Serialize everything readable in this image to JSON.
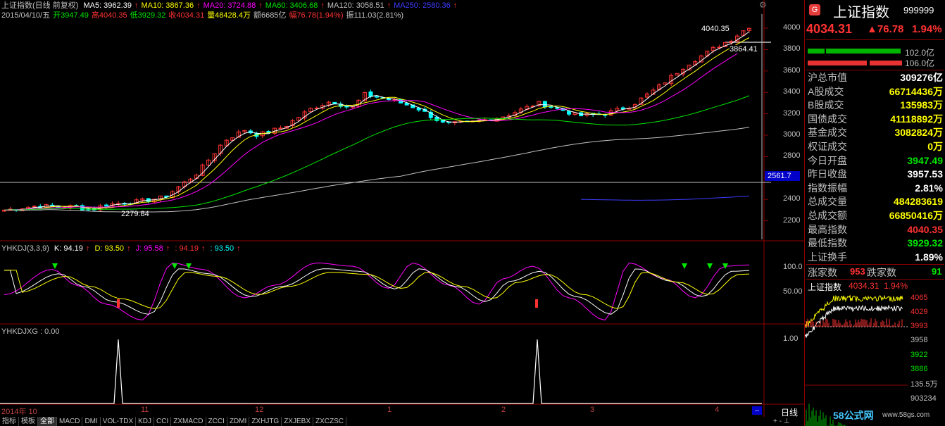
{
  "header": {
    "index_name": "上证指数(日线 前复权)",
    "ma": [
      {
        "label": "MA5: 3962.39",
        "color": "#ffffff"
      },
      {
        "label": "MA10: 3867.36",
        "color": "#ffff00"
      },
      {
        "label": "MA20: 3724.88",
        "color": "#ff00ff"
      },
      {
        "label": "MA60: 3406.68",
        "color": "#00e600"
      },
      {
        "label": "MA120: 3058.51",
        "color": "#c0c0c0"
      },
      {
        "label": "MA250: 2580.36",
        "color": "#3c3cff"
      }
    ],
    "date": "2015/04/10/五",
    "open": "开3947.49",
    "high": "高4040.35",
    "low": "低3929.32",
    "close": "收4034.31",
    "volume": "量48428.4万",
    "amount": "额6685亿",
    "change": "幅76.78(1.94%)",
    "amplitude": "振111.03(2.81%)"
  },
  "price_axis": [
    "4000",
    "3800",
    "3600",
    "3400",
    "3200",
    "3000",
    "2800",
    "2600",
    "2400",
    "2200"
  ],
  "price_marker": "2561.7",
  "annotations": {
    "high": "4040.35",
    "mid": "3864.41",
    "low": "2279.84"
  },
  "kdj": {
    "title": "YHKDJ(3,3,9)",
    "k": "K: 94.19",
    "d": "D: 93.50",
    "j": "J: 95.58",
    "v1": ": 94.19",
    "v2": ": 93.50",
    "axis": [
      "100.0",
      "50.00"
    ]
  },
  "xg": {
    "title": "YHKDJXG : 0.00",
    "axis": [
      "1.00"
    ]
  },
  "date_axis": [
    {
      "label": "2014年 10"
    },
    {
      "label": "11"
    },
    {
      "label": "12"
    },
    {
      "label": "1"
    },
    {
      "label": "2"
    },
    {
      "label": "3"
    },
    {
      "label": "4"
    }
  ],
  "tabs": [
    "指标",
    "模板",
    "全部",
    "MACD",
    "DMI",
    "VOL-TDX",
    "KDJ",
    "CCI",
    "ZXMACD",
    "ZCCI",
    "ZDMI",
    "ZXHJTG",
    "ZXJEBX",
    "ZXCZSC"
  ],
  "period_label": "日线",
  "quote": {
    "name": "上证指数",
    "code": "999999",
    "price": "4034.31",
    "change": "▲76.78",
    "pct": "1.94%",
    "bar1_value": "102.0亿",
    "bar2_value": "106.0亿",
    "rows": [
      {
        "k": "沪总市值",
        "v": "309276亿",
        "color": "#ffffff"
      },
      {
        "k": "A股成交",
        "v": "66714436万",
        "color": "#ffff00"
      },
      {
        "k": "B股成交",
        "v": "135983万",
        "color": "#ffff00"
      },
      {
        "k": "国债成交",
        "v": "41118892万",
        "color": "#ffff00"
      },
      {
        "k": "基金成交",
        "v": "3082824万",
        "color": "#ffff00"
      },
      {
        "k": "权证成交",
        "v": "0万",
        "color": "#ffff00"
      },
      {
        "k": "今日开盘",
        "v": "3947.49",
        "color": "#00e600"
      },
      {
        "k": "昨日收盘",
        "v": "3957.53",
        "color": "#ffffff"
      },
      {
        "k": "指数振幅",
        "v": "2.81%",
        "color": "#ffffff"
      },
      {
        "k": "总成交量",
        "v": "484283619",
        "color": "#ffff00"
      },
      {
        "k": "总成交额",
        "v": "66850416万",
        "color": "#ffff00"
      },
      {
        "k": "最高指数",
        "v": "4040.35",
        "color": "#ff3232"
      },
      {
        "k": "最低指数",
        "v": "3929.32",
        "color": "#00e600"
      },
      {
        "k": "上证换手",
        "v": "1.89%",
        "color": "#ffffff"
      }
    ],
    "up_label": "涨家数",
    "up_count": "953",
    "down_label": "跌家数",
    "down_count": "91",
    "mini_title": "上证指数",
    "mini_price": "4034.31",
    "mini_pct": "1.94%",
    "mini_axis": [
      "4065",
      "4029",
      "3993",
      "3958",
      "3922",
      "3886",
      "135.5万",
      "903234"
    ],
    "watermark": "58公式网",
    "watermark_url": "www.58gs.com"
  }
}
